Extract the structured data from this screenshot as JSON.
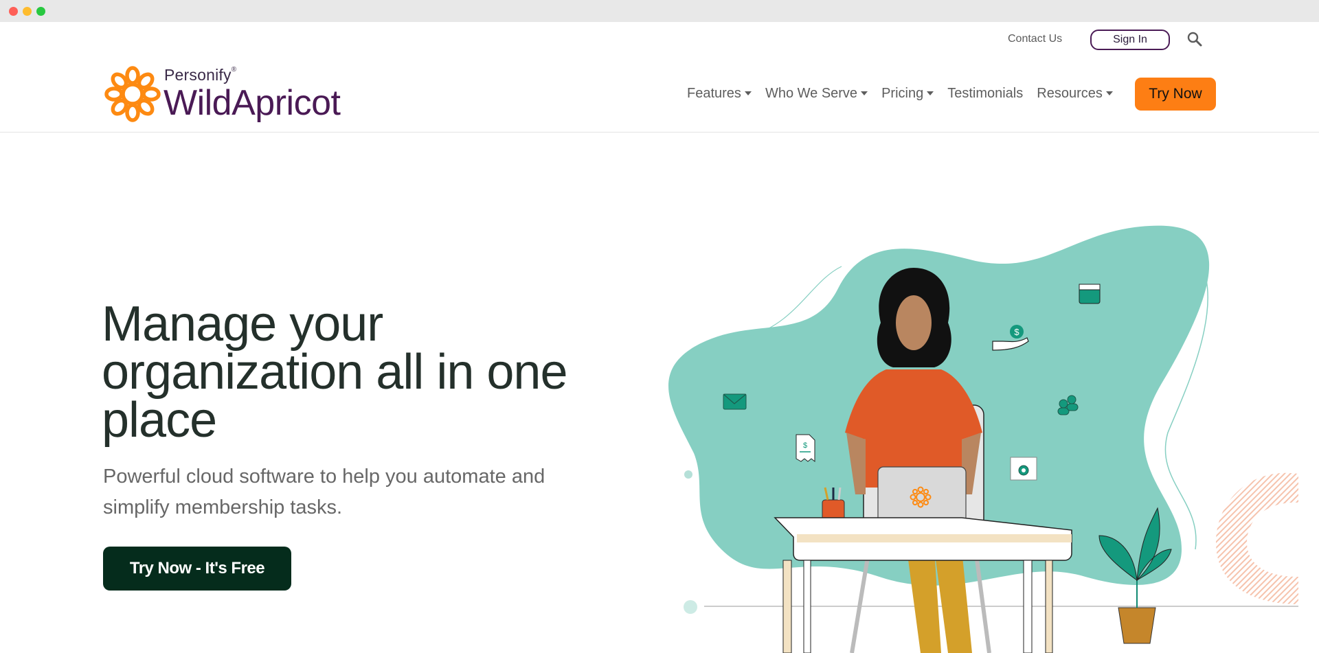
{
  "window": {
    "controls": [
      "close",
      "minimize",
      "maximize"
    ]
  },
  "utility_nav": {
    "contact_label": "Contact Us",
    "signin_label": "Sign In",
    "search_icon": "search-icon"
  },
  "brand": {
    "parent": "Personify",
    "registered": "®",
    "name": "WildApricot",
    "colors": {
      "orange": "#fd7e14",
      "purple": "#4a1a55",
      "dark_green": "#052c1c",
      "teal": "#86cfc2"
    }
  },
  "main_nav": {
    "items": [
      {
        "label": "Features",
        "dropdown": true
      },
      {
        "label": "Who We Serve",
        "dropdown": true
      },
      {
        "label": "Pricing",
        "dropdown": true
      },
      {
        "label": "Testimonials",
        "dropdown": false
      },
      {
        "label": "Resources",
        "dropdown": true
      }
    ],
    "cta_label": "Try Now"
  },
  "hero": {
    "title": "Manage your organization all in one place",
    "subtitle": "Powerful cloud software to help you automate and simplify membership tasks.",
    "cta_label": "Try Now - It's Free"
  },
  "illustration": {
    "description": "Woman working at a laptop on a desk with floating membership icons",
    "floating_icons": [
      "calendar-icon",
      "donation-icon",
      "email-icon",
      "members-icon",
      "invoice-icon",
      "settings-icon"
    ]
  }
}
